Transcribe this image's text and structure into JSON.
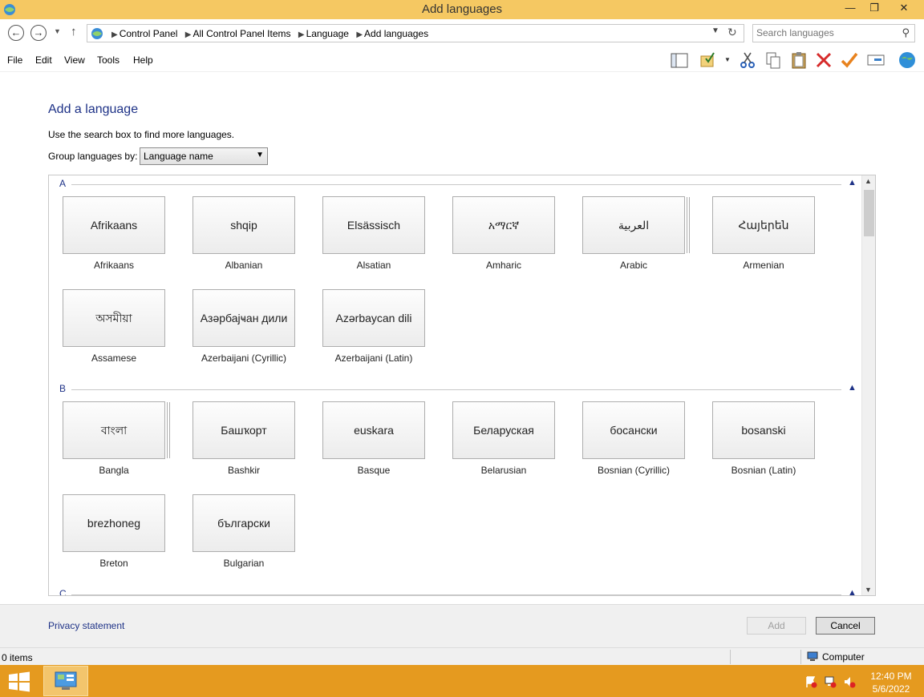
{
  "window": {
    "title": "Add languages",
    "minimize_glyph": "—",
    "restore_glyph": "❐",
    "close_glyph": "✕"
  },
  "address": {
    "crumbs": [
      "Control Panel",
      "All Control Panel Items",
      "Language",
      "Add languages"
    ],
    "search_placeholder": "Search languages"
  },
  "menu": [
    "File",
    "Edit",
    "View",
    "Tools",
    "Help"
  ],
  "toolbar_icons": [
    "pane-icon",
    "folder-check-icon",
    "cut-icon",
    "copy-icon",
    "paste-icon",
    "delete-icon",
    "checkmark-icon",
    "properties-icon",
    "globe-icon"
  ],
  "content": {
    "heading": "Add a language",
    "hint": "Use the search box to find more languages.",
    "group_label": "Group languages by:",
    "group_value": "Language name"
  },
  "groups": [
    {
      "letter": "A",
      "languages": [
        {
          "native": "Afrikaans",
          "name": "Afrikaans"
        },
        {
          "native": "shqip",
          "name": "Albanian"
        },
        {
          "native": "Elsässisch",
          "name": "Alsatian"
        },
        {
          "native": "አማርኛ",
          "name": "Amharic"
        },
        {
          "native": "العربية",
          "name": "Arabic",
          "stacked": true
        },
        {
          "native": "Հայերեն",
          "name": "Armenian"
        },
        {
          "native": "অসমীয়া",
          "name": "Assamese"
        },
        {
          "native": "Азәрбајҹан дили",
          "name": "Azerbaijani (Cyrillic)"
        },
        {
          "native": "Azərbaycan dili",
          "name": "Azerbaijani (Latin)"
        }
      ]
    },
    {
      "letter": "B",
      "languages": [
        {
          "native": "বাংলা",
          "name": "Bangla",
          "stacked": true
        },
        {
          "native": "Башҡорт",
          "name": "Bashkir"
        },
        {
          "native": "euskara",
          "name": "Basque"
        },
        {
          "native": "Беларуская",
          "name": "Belarusian"
        },
        {
          "native": "босански",
          "name": "Bosnian (Cyrillic)"
        },
        {
          "native": "bosanski",
          "name": "Bosnian (Latin)"
        },
        {
          "native": "brezhoneg",
          "name": "Breton"
        },
        {
          "native": "български",
          "name": "Bulgarian"
        }
      ]
    },
    {
      "letter": "C",
      "languages": []
    }
  ],
  "footer": {
    "privacy": "Privacy statement",
    "add_label": "Add",
    "cancel_label": "Cancel"
  },
  "status": {
    "items": "0 items",
    "location": "Computer"
  },
  "taskbar": {
    "time": "12:40 PM",
    "date": "5/6/2022"
  },
  "colors": {
    "titlebar": "#f5c862",
    "taskbar": "#e59a1f",
    "link": "#1e3287"
  }
}
